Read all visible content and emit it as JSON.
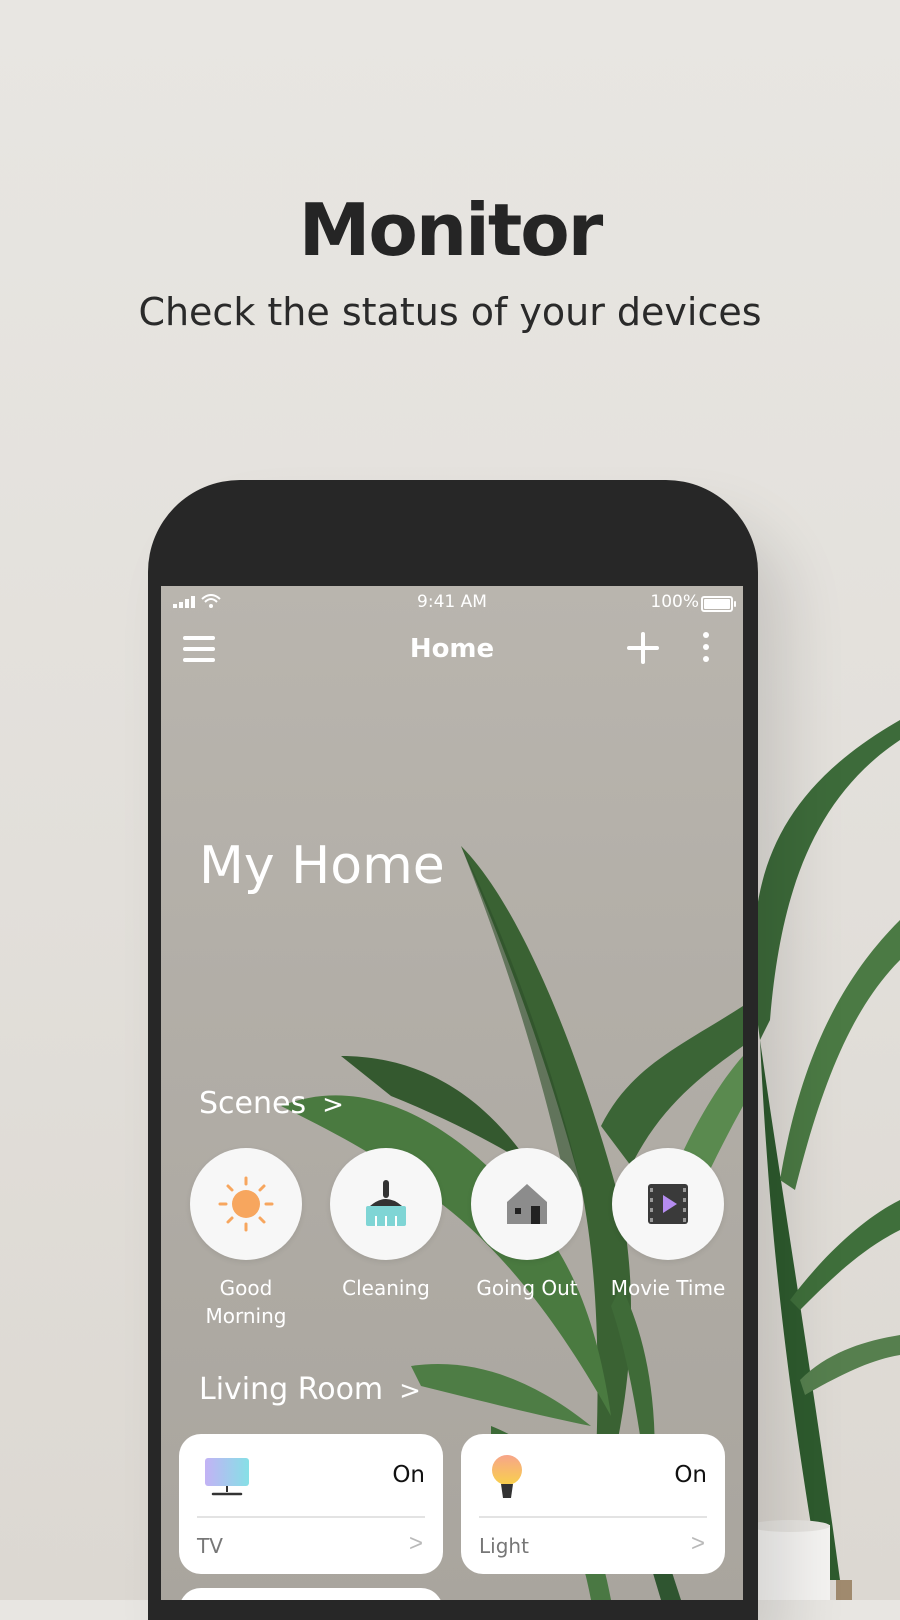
{
  "hero": {
    "title": "Monitor",
    "subtitle": "Check the status of your devices"
  },
  "status_bar": {
    "time": "9:41 AM",
    "battery": "100%"
  },
  "app_header": {
    "title": "Home",
    "icons": [
      "menu-icon",
      "add-icon",
      "more-icon"
    ]
  },
  "home": {
    "name": "My Home"
  },
  "scenes": {
    "title": "Scenes",
    "items": [
      {
        "label": "Good Morning",
        "icon": "sun-icon"
      },
      {
        "label": "Cleaning",
        "icon": "brush-icon"
      },
      {
        "label": "Going Out",
        "icon": "house-icon"
      },
      {
        "label": "Movie Time",
        "icon": "film-play-icon"
      }
    ]
  },
  "room": {
    "title": "Living Room",
    "devices": [
      {
        "name": "TV",
        "status": "On",
        "icon": "tv-icon"
      },
      {
        "name": "Light",
        "status": "On",
        "icon": "bulb-icon"
      }
    ]
  },
  "colors": {
    "screen_bg": "#b5b1aa",
    "phone_frame": "#272727",
    "sun": "#f7a65e",
    "brush_teal": "#7fd5d5",
    "film_purple": "#b58cf0"
  }
}
